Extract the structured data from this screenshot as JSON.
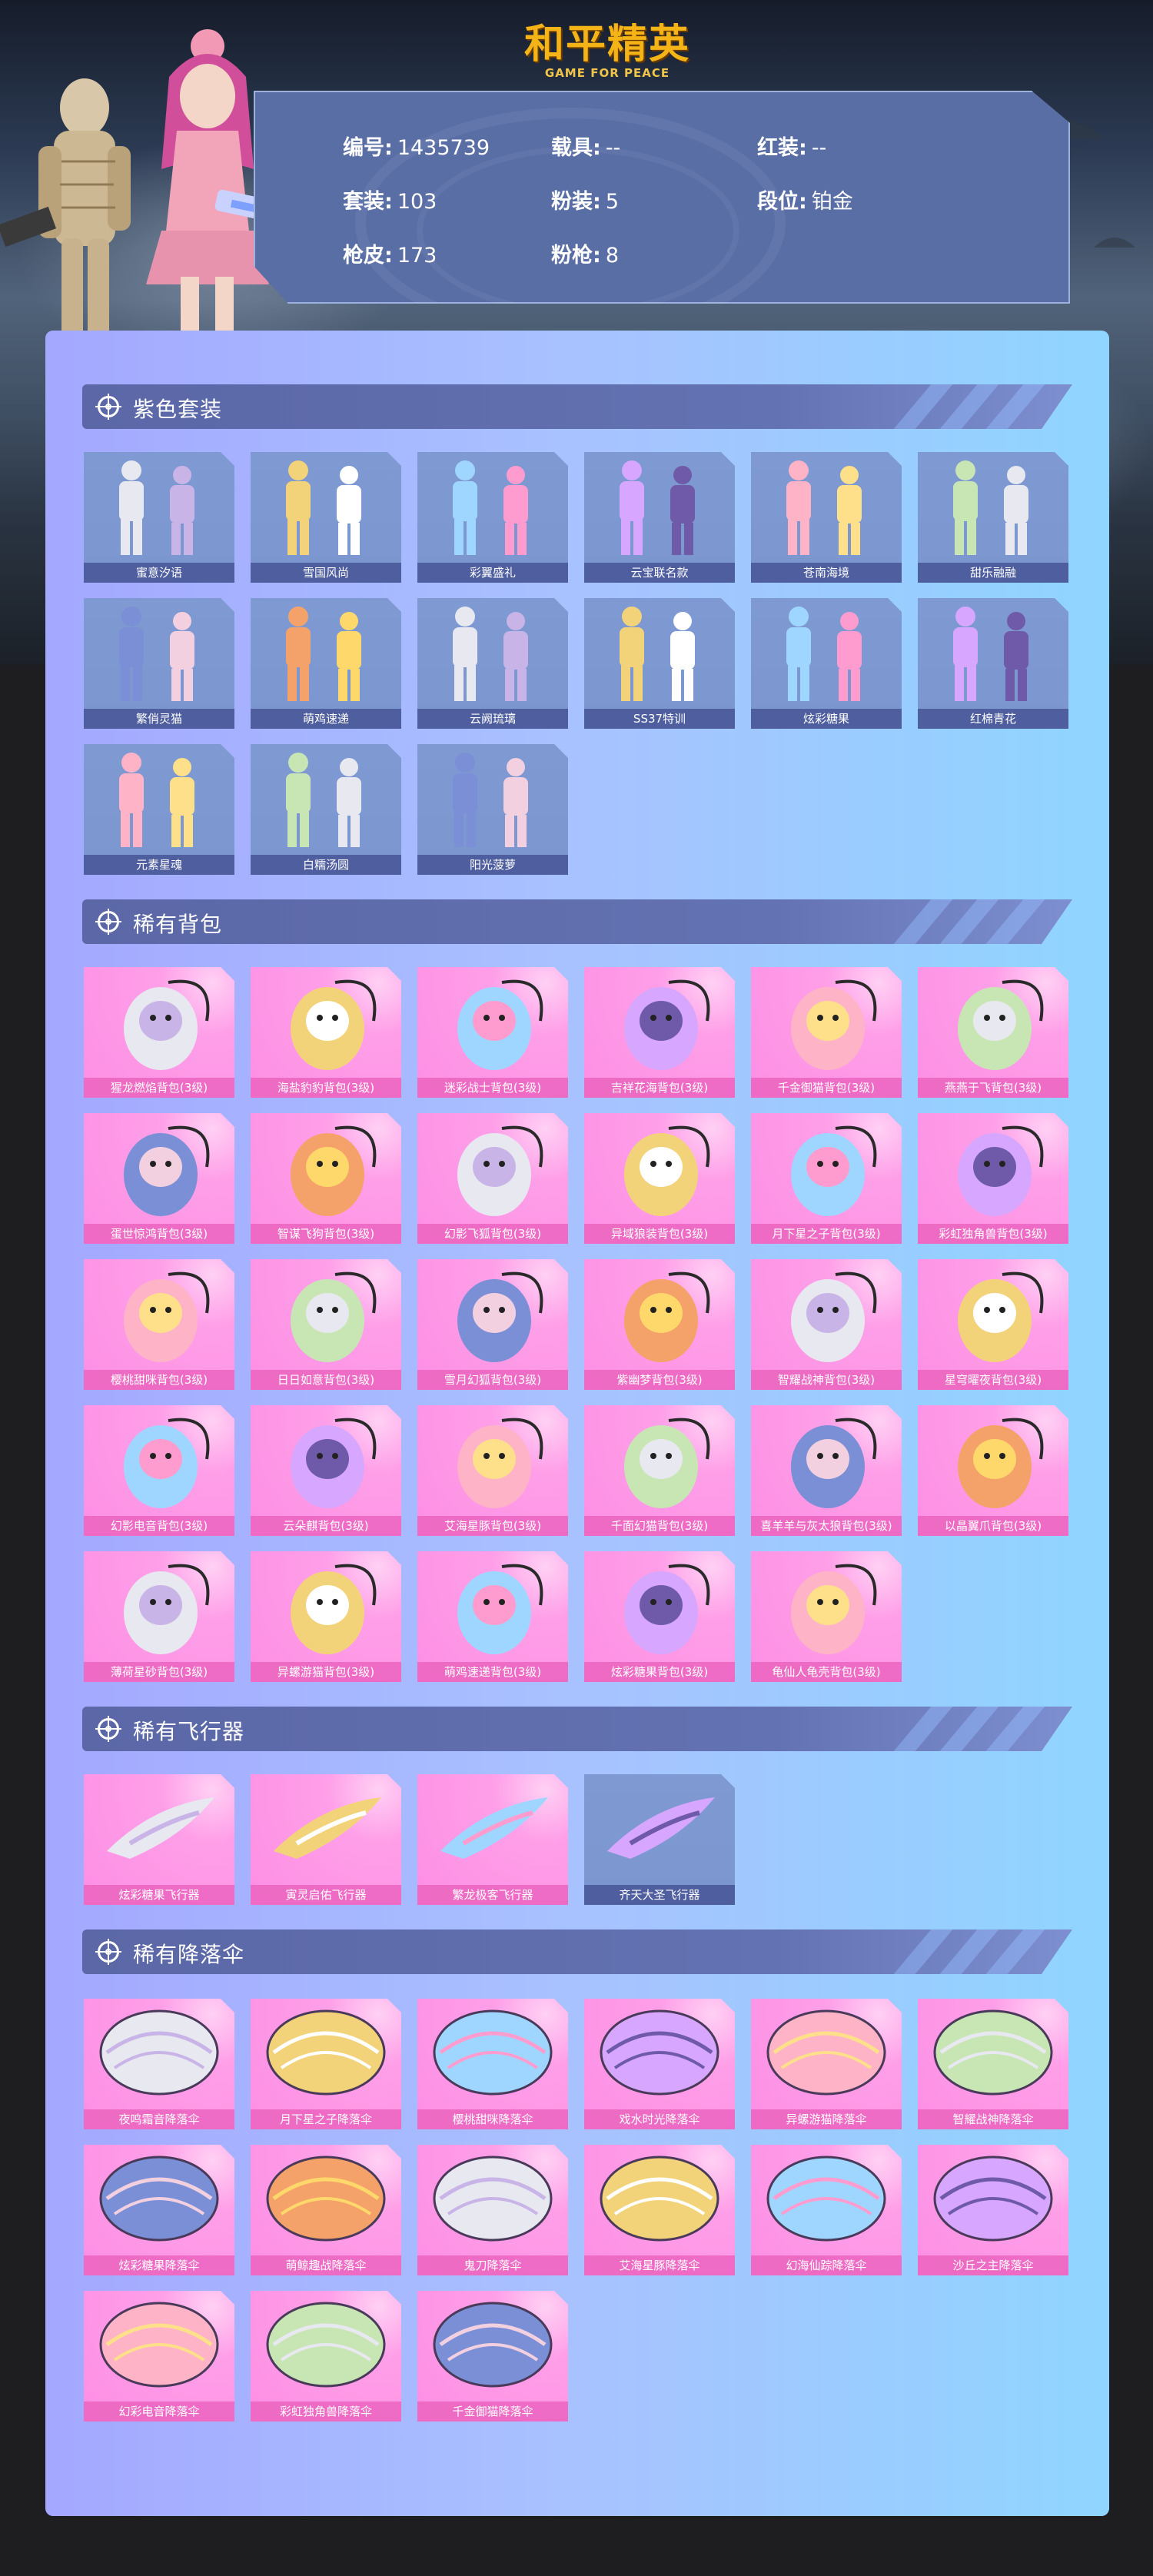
{
  "header": {
    "logo_main": "和平精英",
    "logo_sub": "GAME FOR PEACE"
  },
  "stats": [
    {
      "key": "编号:",
      "value": "1435739"
    },
    {
      "key": "载具:",
      "value": "--"
    },
    {
      "key": "红装:",
      "value": "--"
    },
    {
      "key": "套装:",
      "value": "103"
    },
    {
      "key": "粉装:",
      "value": "5"
    },
    {
      "key": "段位:",
      "value": "铂金"
    },
    {
      "key": "枪皮:",
      "value": "173"
    },
    {
      "key": "粉枪:",
      "value": "8"
    }
  ],
  "sections": {
    "suits": {
      "title": "紫色套装",
      "items": [
        "蜜意汐语",
        "雪国风尚",
        "彩翼盛礼",
        "云宝联名款",
        "苍南海境",
        "甜乐融融",
        "繁俏灵猫",
        "萌鸡速递",
        "云阙琉璃",
        "SS37特训",
        "炫彩糖果",
        "红棉青花",
        "元素星魂",
        "白糯汤圆",
        "阳光菠萝"
      ]
    },
    "backpacks": {
      "title": "稀有背包",
      "items": [
        "猩龙燃焰背包(3级)",
        "海盐豹豹背包(3级)",
        "迷彩战士背包(3级)",
        "吉祥花海背包(3级)",
        "千金御猫背包(3级)",
        "燕燕于飞背包(3级)",
        "蛋世惊鸿背包(3级)",
        "智谋飞狗背包(3级)",
        "幻影飞狐背包(3级)",
        "异域狼装背包(3级)",
        "月下星之子背包(3级)",
        "彩虹独角兽背包(3级)",
        "樱桃甜咪背包(3级)",
        "日日如意背包(3级)",
        "雪月幻狐背包(3级)",
        "紫幽梦背包(3级)",
        "智耀战神背包(3级)",
        "星穹曜夜背包(3级)",
        "幻影电音背包(3级)",
        "云朵麒背包(3级)",
        "艾海星豚背包(3级)",
        "千面幻猫背包(3级)",
        "喜羊羊与灰太狼背包(3级)",
        "以晶翼爪背包(3级)",
        "薄荷星砂背包(3级)",
        "异螺游猫背包(3级)",
        "萌鸡速递背包(3级)",
        "炫彩糖果背包(3级)",
        "龟仙人龟壳背包(3级)"
      ]
    },
    "aircraft": {
      "title": "稀有飞行器",
      "items": [
        "炫彩糖果飞行器",
        "寅灵启佑飞行器",
        "繁龙极客飞行器",
        "齐天大圣飞行器"
      ]
    },
    "parachutes": {
      "title": "稀有降落伞",
      "items": [
        "夜鸣霜音降落伞",
        "月下星之子降落伞",
        "樱桃甜咪降落伞",
        "戏水时光降落伞",
        "异螺游猫降落伞",
        "智耀战神降落伞",
        "炫彩糖果降落伞",
        "萌鲸趣战降落伞",
        "鬼刀降落伞",
        "艾海星豚降落伞",
        "幻海仙踪降落伞",
        "沙丘之主降落伞",
        "幻彩电音降落伞",
        "彩虹独角兽降落伞",
        "千金御猫降落伞"
      ]
    }
  },
  "colors": {
    "accent_gold": "#f4b317",
    "panel_blue": "#5a6ea6",
    "card_pink": "#fd8ee4",
    "card_purple": "#7f9ad2"
  }
}
